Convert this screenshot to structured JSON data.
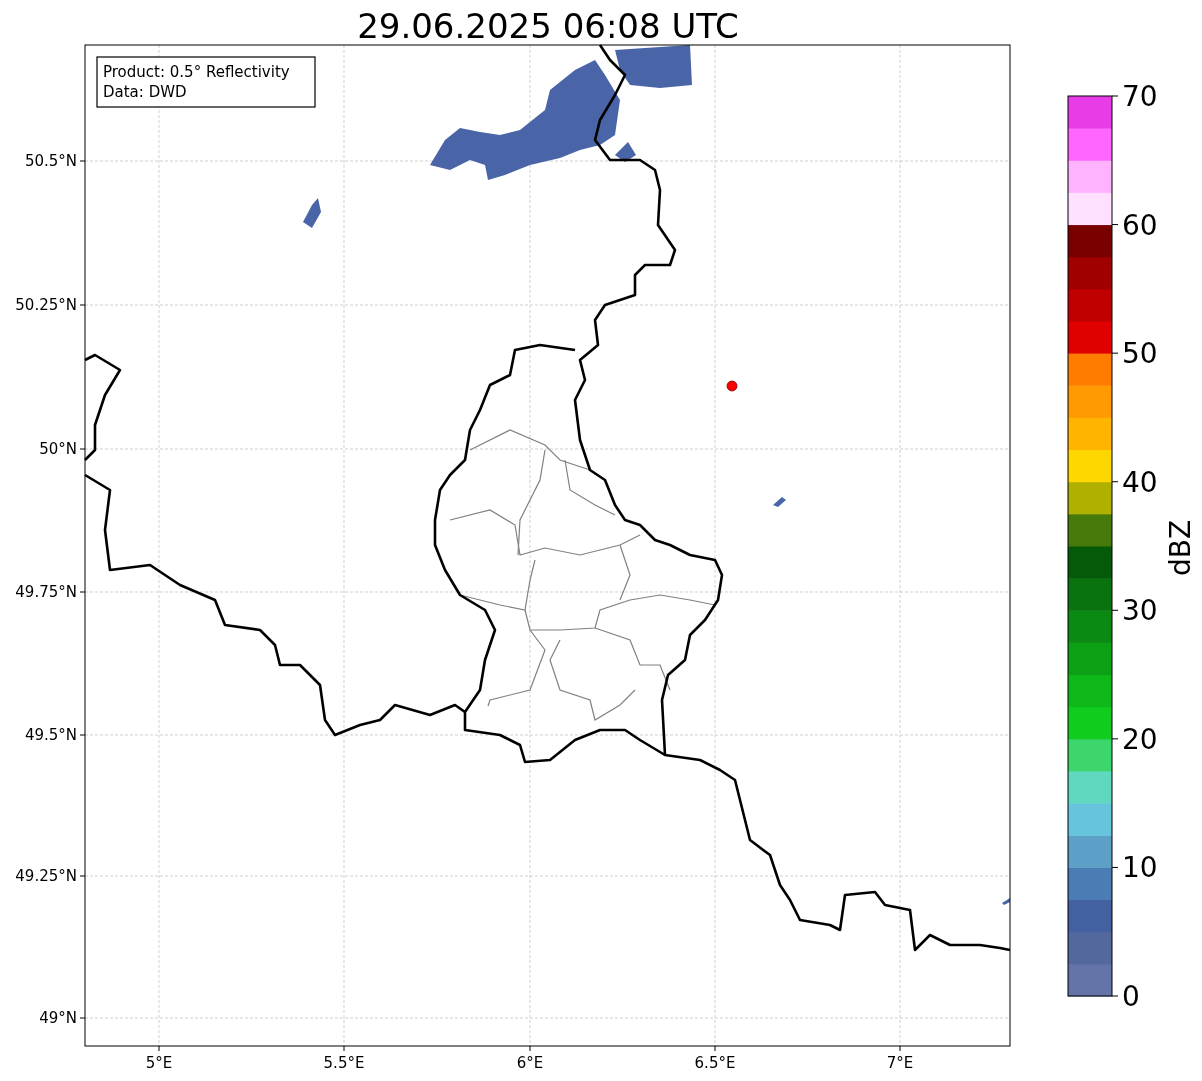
{
  "title": "29.06.2025 06:08 UTC",
  "info_box": {
    "lines": [
      "Product: 0.5° Reflectivity",
      "Data: DWD"
    ]
  },
  "map": {
    "y_ticks": [
      "50.5°N",
      "50.25°N",
      "50°N",
      "49.75°N",
      "49.5°N",
      "49.25°N",
      "49°N"
    ],
    "x_ticks": [
      "5°E",
      "5.5°E",
      "6°E",
      "6.5°E",
      "7°E"
    ],
    "marker": {
      "color": "#ff0000"
    }
  },
  "colorbar": {
    "label": "dBZ",
    "ticks": [
      "70",
      "60",
      "50",
      "40",
      "30",
      "20",
      "10",
      "0"
    ],
    "bands": [
      {
        "color": "#6474a8"
      },
      {
        "color": "#53699e"
      },
      {
        "color": "#4360a0"
      },
      {
        "color": "#4b7cb4"
      },
      {
        "color": "#5ca0c8"
      },
      {
        "color": "#66c4dc"
      },
      {
        "color": "#60d8c0"
      },
      {
        "color": "#3cd66c"
      },
      {
        "color": "#10cc1c"
      },
      {
        "color": "#0eb818"
      },
      {
        "color": "#0ca014"
      },
      {
        "color": "#0a8a12"
      },
      {
        "color": "#08730f"
      },
      {
        "color": "#055a0a"
      },
      {
        "color": "#467a0a"
      },
      {
        "color": "#b0b000"
      },
      {
        "color": "#ffd700"
      },
      {
        "color": "#ffb400"
      },
      {
        "color": "#ff9a00"
      },
      {
        "color": "#ff7c00"
      },
      {
        "color": "#e00000"
      },
      {
        "color": "#c00000"
      },
      {
        "color": "#a00000"
      },
      {
        "color": "#780000"
      },
      {
        "color": "#ffe0ff"
      },
      {
        "color": "#ffb3ff"
      },
      {
        "color": "#ff66ff"
      },
      {
        "color": "#e83ce8"
      }
    ]
  }
}
